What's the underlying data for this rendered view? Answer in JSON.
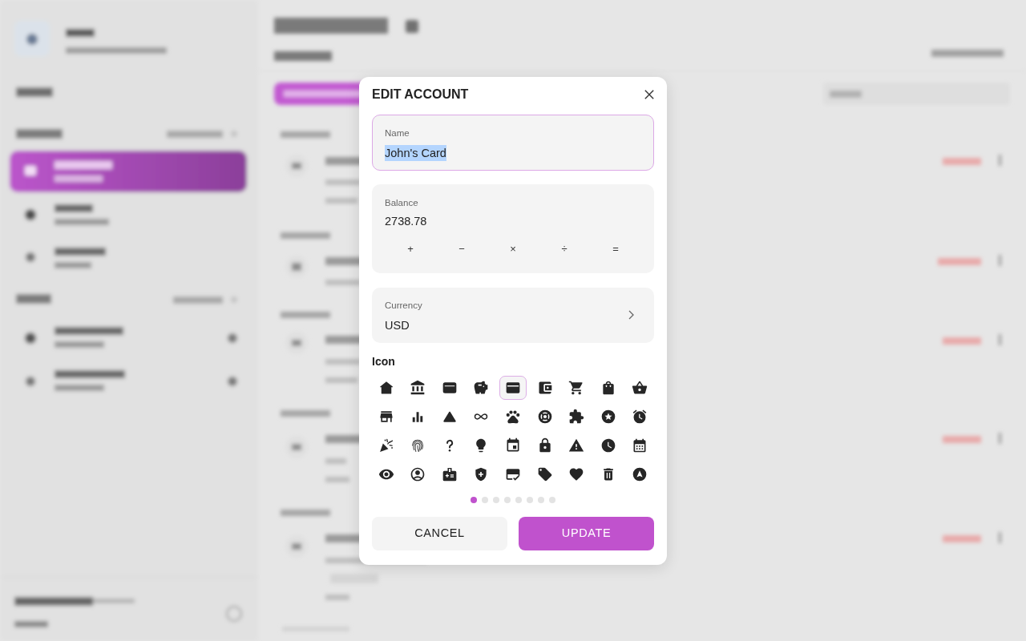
{
  "dialog": {
    "title": "EDIT ACCOUNT",
    "name_field": {
      "label": "Name",
      "value": "John's Card",
      "focused": true,
      "text_selected": true
    },
    "balance_field": {
      "label": "Balance",
      "value": "2738.78",
      "operators": [
        "+",
        "−",
        "×",
        "÷",
        "="
      ]
    },
    "currency_field": {
      "label": "Currency",
      "value": "USD"
    },
    "icon_picker": {
      "label": "Icon",
      "icons": [
        {
          "kind": "home",
          "selected": false
        },
        {
          "kind": "bank",
          "selected": false
        },
        {
          "kind": "card-holder",
          "selected": false
        },
        {
          "kind": "piggy-bank",
          "selected": false
        },
        {
          "kind": "credit-card",
          "selected": true
        },
        {
          "kind": "wallet",
          "selected": false
        },
        {
          "kind": "cart",
          "selected": false
        },
        {
          "kind": "bag",
          "selected": false
        },
        {
          "kind": "basket",
          "selected": false
        },
        {
          "kind": "store",
          "selected": false
        },
        {
          "kind": "bar-chart",
          "selected": false
        },
        {
          "kind": "triangle",
          "selected": false
        },
        {
          "kind": "infinity",
          "selected": false
        },
        {
          "kind": "paw",
          "selected": false
        },
        {
          "kind": "lifebuoy",
          "selected": false
        },
        {
          "kind": "puzzle",
          "selected": false
        },
        {
          "kind": "star-circle",
          "selected": false
        },
        {
          "kind": "alarm",
          "selected": false
        },
        {
          "kind": "party",
          "selected": false
        },
        {
          "kind": "fingerprint",
          "selected": false
        },
        {
          "kind": "question",
          "selected": false
        },
        {
          "kind": "bulb",
          "selected": false
        },
        {
          "kind": "calendar-day",
          "selected": false
        },
        {
          "kind": "lock",
          "selected": false
        },
        {
          "kind": "warning",
          "selected": false
        },
        {
          "kind": "clock",
          "selected": false
        },
        {
          "kind": "calendar",
          "selected": false
        },
        {
          "kind": "eye",
          "selected": false
        },
        {
          "kind": "person-circle",
          "selected": false
        },
        {
          "kind": "id-card",
          "selected": false
        },
        {
          "kind": "shield",
          "selected": false
        },
        {
          "kind": "card-check",
          "selected": false
        },
        {
          "kind": "tag",
          "selected": false
        },
        {
          "kind": "heart",
          "selected": false
        },
        {
          "kind": "trash",
          "selected": false
        },
        {
          "kind": "navigation",
          "selected": false
        }
      ],
      "pages": [
        {
          "selected": true
        },
        {
          "selected": false
        },
        {
          "selected": false
        },
        {
          "selected": false
        },
        {
          "selected": false
        },
        {
          "selected": false
        },
        {
          "selected": false
        },
        {
          "selected": false
        }
      ]
    },
    "buttons": [
      {
        "label": "CANCEL",
        "kind": "secondary"
      },
      {
        "label": "UPDATE",
        "kind": "primary"
      }
    ]
  }
}
